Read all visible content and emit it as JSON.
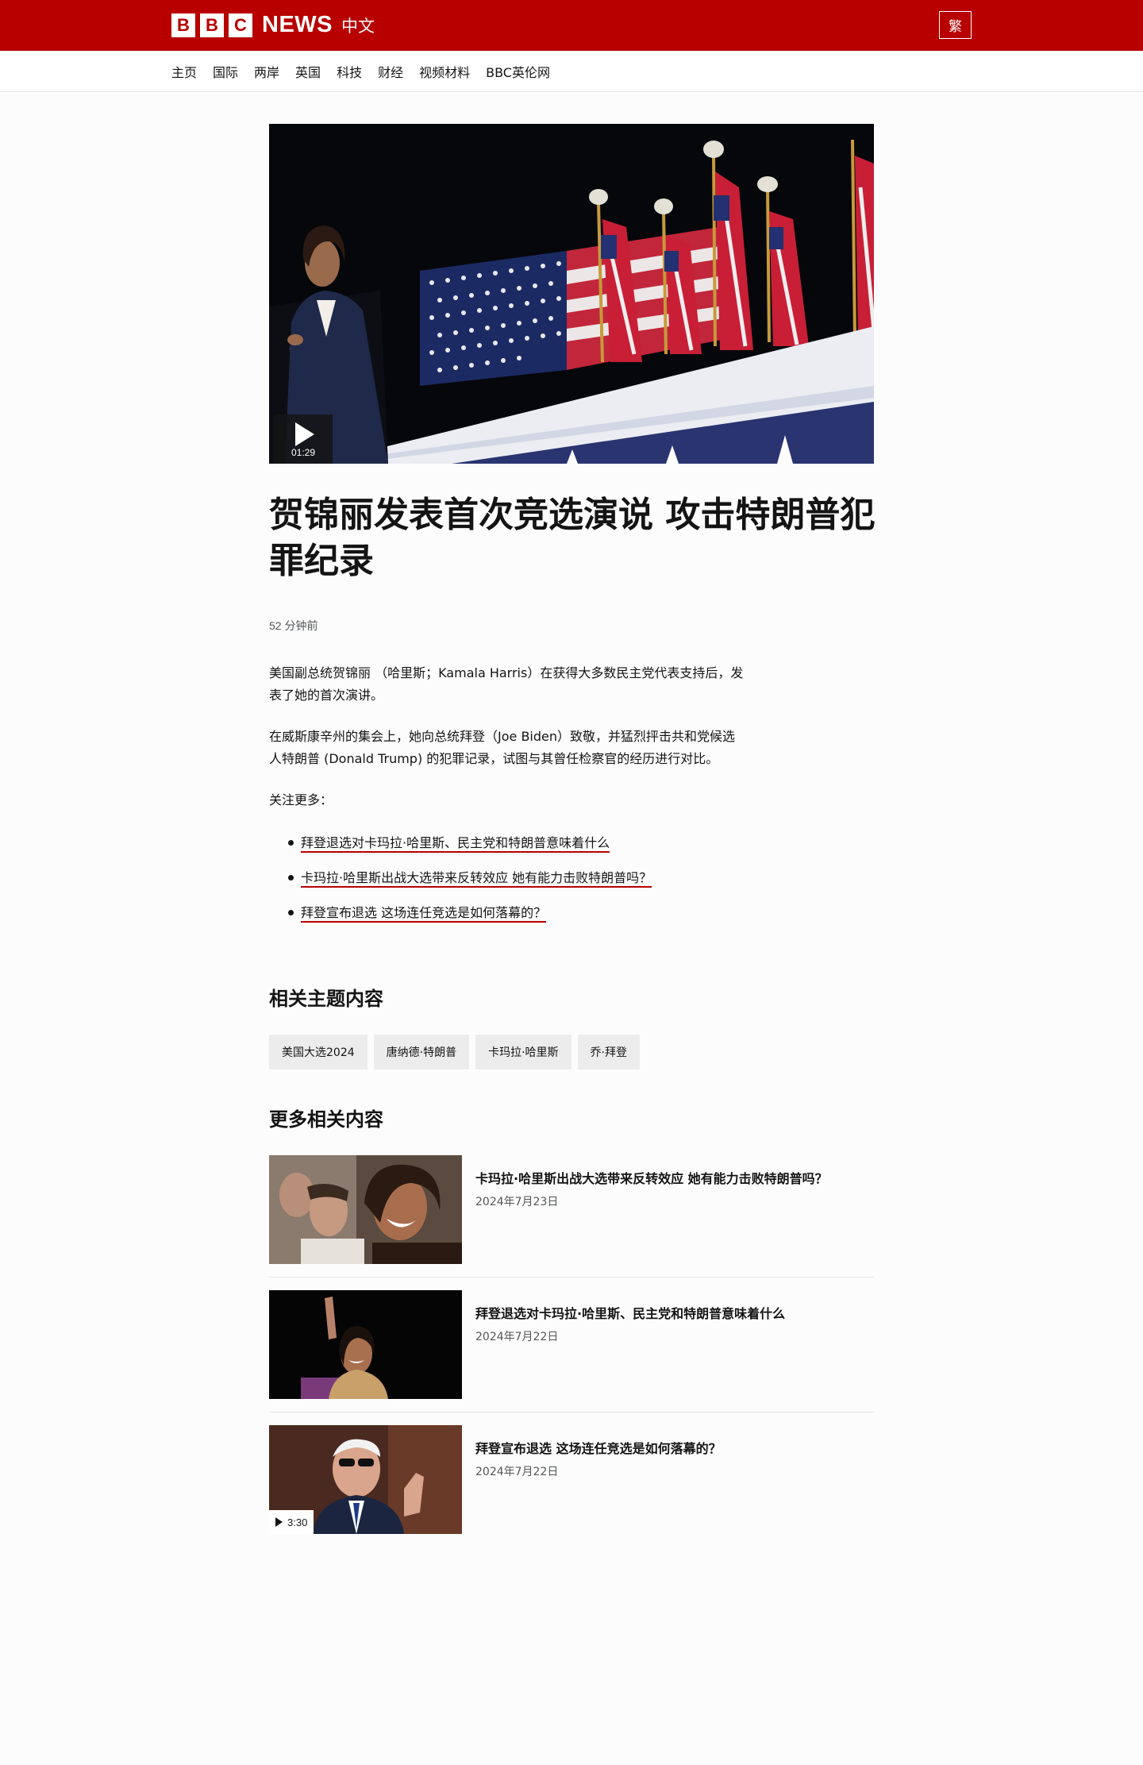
{
  "header": {
    "logo_blocks": [
      "B",
      "B",
      "C"
    ],
    "logo_news": "NEWS",
    "logo_lang": "中文",
    "script_toggle": "繁",
    "brand_color": "#b80000"
  },
  "nav": {
    "items": [
      "主页",
      "国际",
      "两岸",
      "英国",
      "科技",
      "财经",
      "视频材料",
      "BBC英伦网"
    ]
  },
  "hero": {
    "duration": "01:29",
    "play_icon": "play-icon"
  },
  "article": {
    "headline": "贺锦丽发表首次竞选演说 攻击特朗普犯罪纪录",
    "timestamp": "52 分钟前",
    "paragraphs": [
      "美国副总统贺锦丽 （哈里斯；Kamala Harris）在获得大多数民主党代表支持后，发表了她的首次演讲。",
      "在威斯康辛州的集会上，她向总统拜登（Joe Biden）致敬，并猛烈抨击共和党候选人特朗普 (Donald Trump) 的犯罪记录，试图与其曾任检察官的经历进行对比。",
      "关注更多："
    ],
    "more_links": [
      "拜登退选对卡玛拉·哈里斯、民主党和特朗普意味着什么",
      "卡玛拉·哈里斯出战大选带来反转效应 她有能力击败特朗普吗？",
      "拜登宣布退选 这场连任竞选是如何落幕的？"
    ]
  },
  "topics": {
    "title": "相关主题内容",
    "items": [
      "美国大选2024",
      "唐纳德·特朗普",
      "卡玛拉·哈里斯",
      "乔·拜登"
    ]
  },
  "related": {
    "title": "更多相关内容",
    "items": [
      {
        "title": "卡玛拉·哈里斯出战大选带来反转效应 她有能力击败特朗普吗？",
        "date": "2024年7月23日",
        "duration": ""
      },
      {
        "title": "拜登退选对卡玛拉·哈里斯、民主党和特朗普意味着什么",
        "date": "2024年7月22日",
        "duration": ""
      },
      {
        "title": "拜登宣布退选 这场连任竞选是如何落幕的？",
        "date": "2024年7月22日",
        "duration": "3:30"
      }
    ]
  }
}
